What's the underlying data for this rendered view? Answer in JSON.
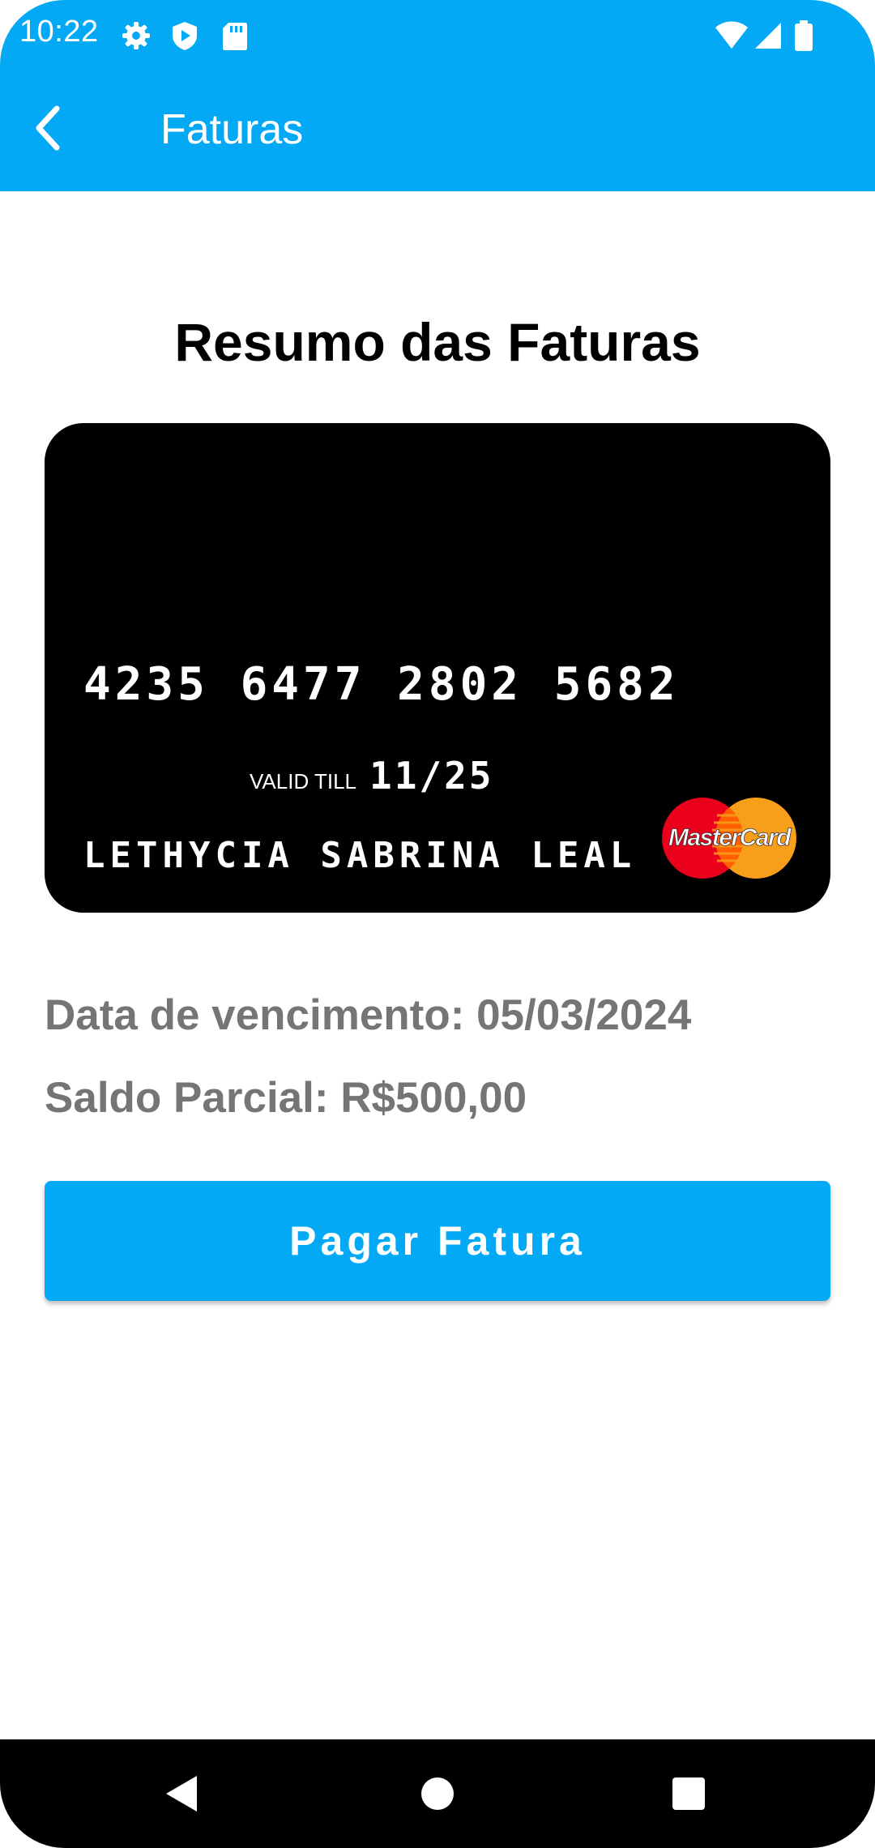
{
  "status_bar": {
    "time": "10:22",
    "left_icons": [
      "settings-icon",
      "shield-play-icon",
      "sd-card-icon"
    ],
    "right_icons": [
      "wifi-icon",
      "signal-icon",
      "battery-icon"
    ]
  },
  "app_bar": {
    "title": "Faturas",
    "back_icon": "chevron-left-icon"
  },
  "main": {
    "title": "Resumo das Faturas",
    "card": {
      "number": "4235 6477 2802 5682",
      "valid_label": "VALID TILL",
      "valid_value": "11/25",
      "holder": "LETHYCIA SABRINA LEAL",
      "brand": "MasterCard"
    },
    "due_date": "Data de vencimento: 05/03/2024",
    "partial_balance": "Saldo Parcial: R$500,00",
    "pay_button": "Pagar Fatura"
  },
  "nav_bar": {
    "back": "nav-back-icon",
    "home": "nav-home-icon",
    "recents": "nav-recents-icon"
  },
  "colors": {
    "primary": "#03A9F4",
    "card": "#000000",
    "info_text": "#757575",
    "mc_red": "#EB001B",
    "mc_orange": "#F79E1B"
  }
}
